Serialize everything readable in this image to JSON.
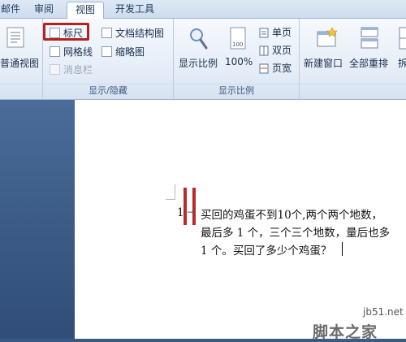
{
  "tabs": [
    {
      "label": "邮件"
    },
    {
      "label": "审阅"
    },
    {
      "label": "视图",
      "active": true
    },
    {
      "label": "开发工具"
    }
  ],
  "ribbon": {
    "views_group": {
      "label_partial": "普通视图"
    },
    "show_hide": {
      "group_label": "显示/隐藏",
      "ruler": {
        "label": "标尺",
        "checked": false,
        "highlighted": true,
        "highlight_color": "#b22222"
      },
      "gridlines": {
        "label": "网格线",
        "checked": false
      },
      "message_bar": {
        "label": "消息栏",
        "checked": false,
        "disabled": true
      },
      "doc_map": {
        "label": "文档结构图",
        "checked": false
      },
      "thumbnails": {
        "label": "缩略图",
        "checked": false
      }
    },
    "zoom": {
      "group_label": "显示比例",
      "zoom_label": "显示比例",
      "percent_label": "100%",
      "one_page": "单页",
      "two_pages": "双页",
      "page_width": "页宽"
    },
    "window": {
      "new_window": "新建窗口",
      "arrange_all": "全部重排",
      "split_partial": "拆"
    }
  },
  "document": {
    "number": "1",
    "line1": "买回的鸡蛋不到10个,两个两个地数，",
    "line2": "最后多 1 个，三个三个地数，量后也多",
    "line3": "1 个。买回了多少个鸡蛋？",
    "marker_color": "#b72b2b"
  },
  "watermark": {
    "site": "jb51.net",
    "name": "脚本之家"
  }
}
